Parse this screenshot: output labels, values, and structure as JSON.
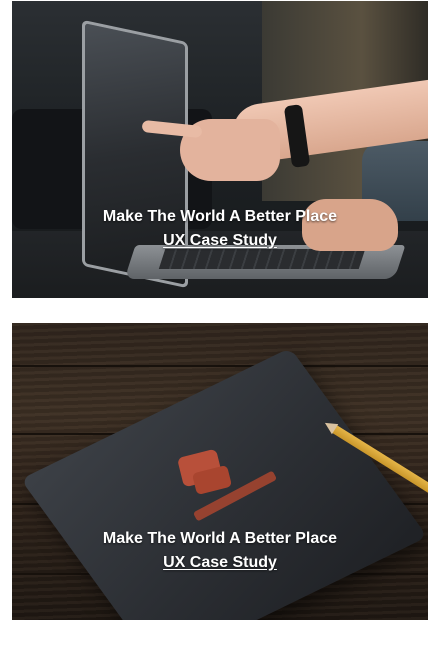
{
  "cards": [
    {
      "title": "Make The World A Better Place",
      "link_label": "UX Case Study",
      "image_subject": "laptop-hands-photo"
    },
    {
      "title": "Make The World A Better Place",
      "link_label": "UX Case Study",
      "image_subject": "notebook-write-ideas-photo"
    }
  ],
  "colors": {
    "caption_text": "#ffffff",
    "page_background": "#ffffff"
  }
}
